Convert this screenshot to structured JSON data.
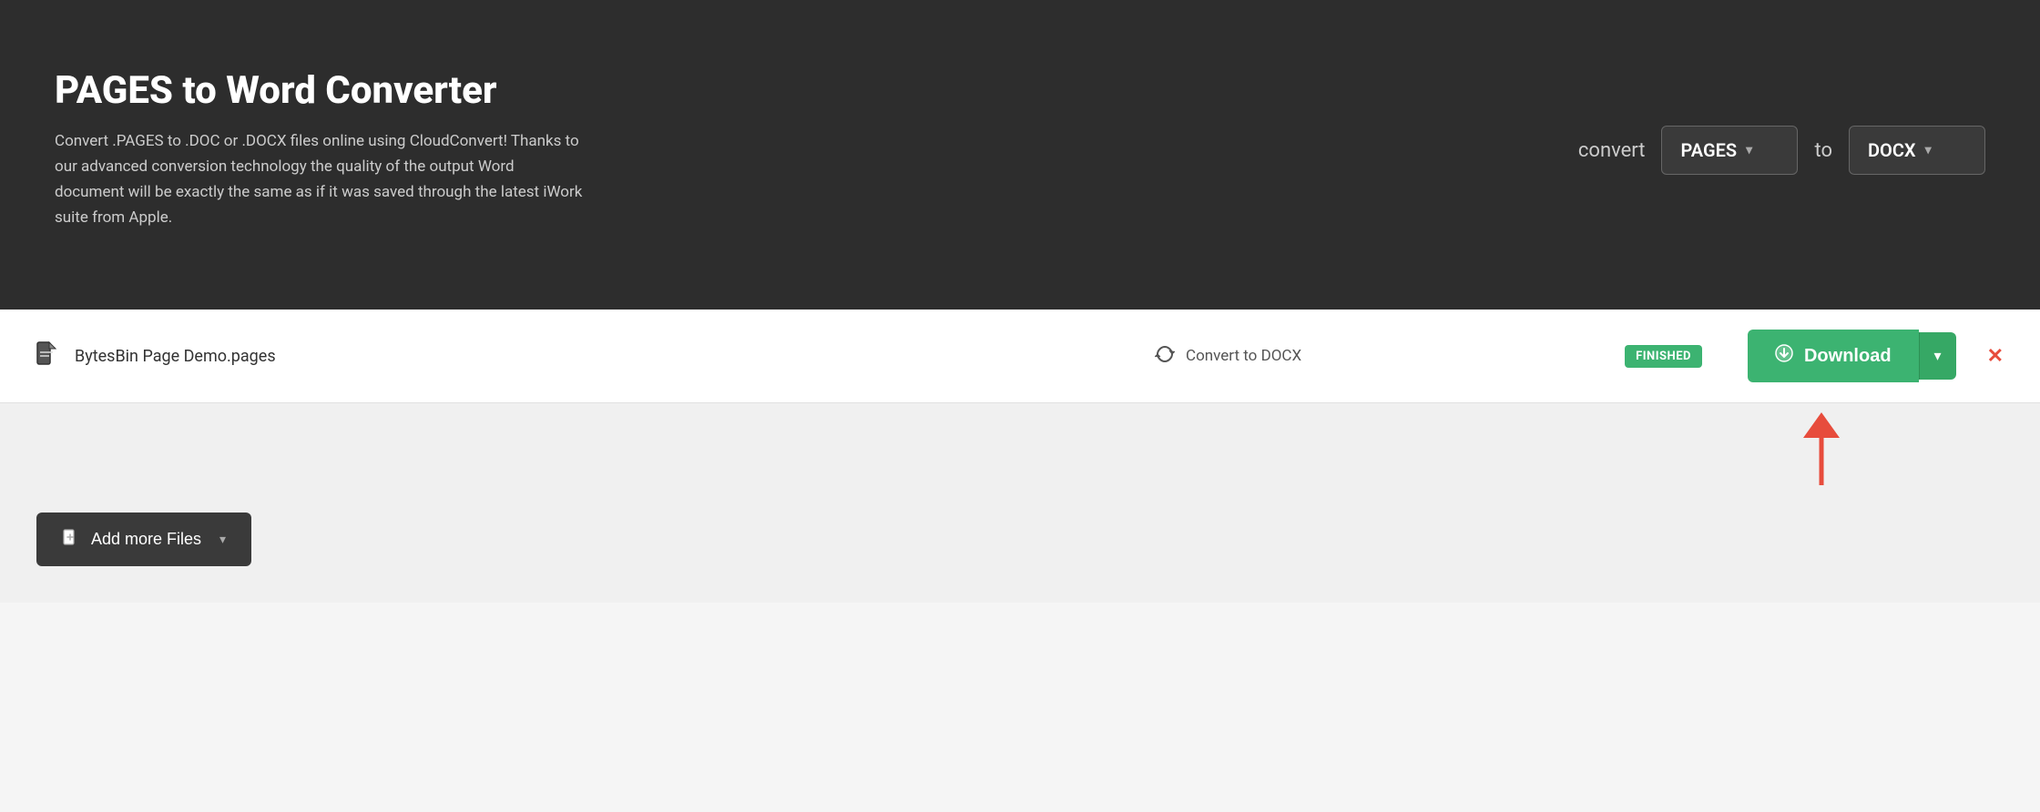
{
  "header": {
    "title": "PAGES to Word Converter",
    "description": "Convert .PAGES to .DOC or .DOCX files online using CloudConvert! Thanks to our advanced conversion technology the quality of the output Word document will be exactly the same as if it was saved through the latest iWork suite from Apple.",
    "convert_label": "convert",
    "from_format": "PAGES",
    "to_label": "to",
    "to_format": "DOCX"
  },
  "file_row": {
    "file_name": "BytesBin Page Demo.pages",
    "convert_text": "Convert to DOCX",
    "status": "FINISHED",
    "download_label": "Download",
    "close_label": "✕"
  },
  "toolbar": {
    "add_files_label": "Add more Files"
  },
  "icons": {
    "file": "📄",
    "convert": "🔄",
    "download": "⬇",
    "add": "➕",
    "chevron_down": "▾",
    "close": "✕"
  },
  "colors": {
    "header_bg": "#2d2d2d",
    "green": "#3cb371",
    "dark_btn": "#3a3a3a",
    "red": "#e74c3c"
  }
}
